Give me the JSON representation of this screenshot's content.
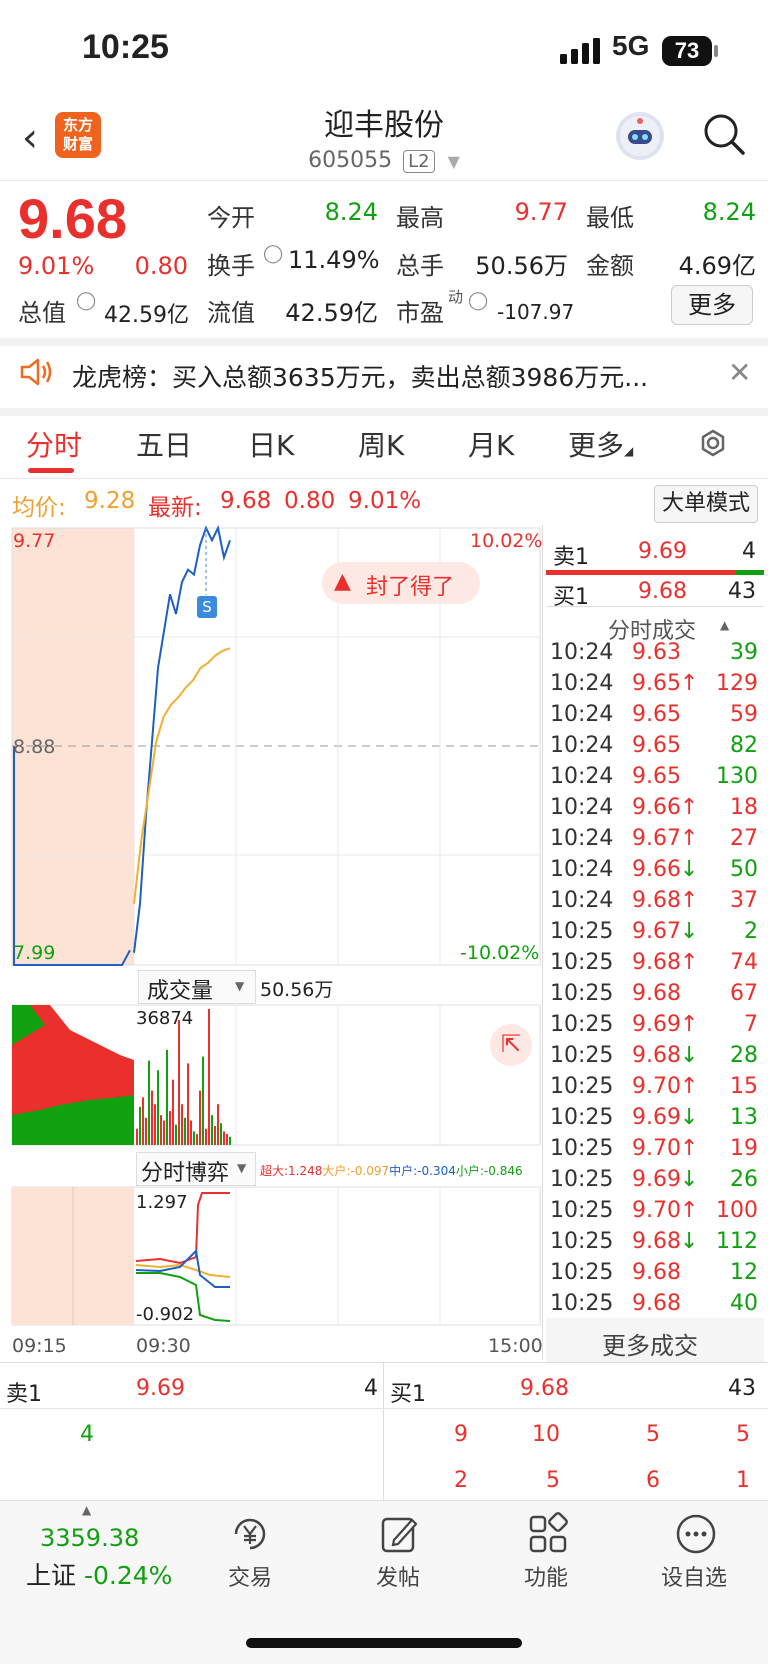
{
  "status_bar": {
    "time": "10:25",
    "network": "5G",
    "battery": "73"
  },
  "header": {
    "app_logo": "东方\n财富",
    "stock_name": "迎丰股份",
    "stock_code": "605055",
    "level": "L2"
  },
  "quote": {
    "price": "9.68",
    "change_pct": "9.01%",
    "change": "0.80",
    "open_label": "今开",
    "open": "8.24",
    "high_label": "最高",
    "high": "9.77",
    "low_label": "最低",
    "low": "8.24",
    "turnover_label": "换手",
    "turnover": "11.49%",
    "volume_label": "总手",
    "volume": "50.56万",
    "amount_label": "金额",
    "amount": "4.69亿",
    "mcap_label": "总值",
    "mcap": "42.59亿",
    "float_label": "流值",
    "float": "42.59亿",
    "pe_label": "市盈",
    "pe_sup": "动",
    "pe": "-107.97",
    "more": "更多"
  },
  "banner": {
    "text": "龙虎榜：买入总额3635万元，卖出总额3986万元..."
  },
  "tabs": [
    "分时",
    "五日",
    "日K",
    "周K",
    "月K",
    "更多"
  ],
  "info": {
    "avg_label": "均价:",
    "avg": "9.28",
    "latest_label": "最新:",
    "latest": "9.68",
    "change": "0.80",
    "pct": "9.01%",
    "big_order": "大单模式"
  },
  "chart": {
    "y_top": "9.77",
    "y_mid": "8.88",
    "y_bottom": "7.99",
    "pct_top": "10.02%",
    "pct_bottom": "-10.02%",
    "badge": "封了得了",
    "volume_label": "成交量",
    "volume_total": "50.56万",
    "volume_max": "36874",
    "game_label": "分时博弈",
    "game_legend": [
      "超大:1.248",
      "大户:-0.097",
      "中户:-0.304",
      "小户:-0.846"
    ],
    "game_top": "1.297",
    "game_bottom": "-0.902",
    "time_labels": [
      "09:15",
      "09:30",
      "15:00"
    ],
    "price_series": [
      7.99,
      7.99,
      7.99,
      8.04,
      8.24,
      8.6,
      8.9,
      9.2,
      9.35,
      9.5,
      9.42,
      9.55,
      9.6,
      9.58,
      9.7,
      9.77,
      9.72,
      9.77,
      9.65,
      9.72
    ],
    "avg_series": [
      8.24,
      8.5,
      8.7,
      8.9,
      9.0,
      9.05,
      9.08,
      9.12,
      9.15,
      9.2,
      9.22,
      9.25,
      9.27,
      9.28
    ],
    "volume_bars": [
      12,
      28,
      35,
      20,
      62,
      40,
      30,
      55,
      22,
      18,
      70,
      25,
      48,
      15,
      92,
      30,
      20,
      60,
      18,
      10,
      8,
      40,
      65,
      12,
      100,
      22,
      14,
      30,
      16,
      10,
      8,
      6
    ],
    "colors": {
      "up": "#e9302d",
      "down": "#10a010",
      "price_line": "#1f5fc0",
      "avg_line": "#f0b030",
      "preopen_bg": "#fde3d6"
    }
  },
  "orderbook_top": {
    "sell_label": "卖1",
    "sell_price": "9.69",
    "sell_vol": "4",
    "buy_label": "买1",
    "buy_price": "9.68",
    "buy_vol": "43"
  },
  "trades_title": "分时成交",
  "trades": [
    {
      "t": "10:24",
      "p": "9.63",
      "a": "",
      "v": "39",
      "c": "red",
      "vc": "green"
    },
    {
      "t": "10:24",
      "p": "9.65",
      "a": "↑",
      "v": "129",
      "c": "red",
      "vc": "red"
    },
    {
      "t": "10:24",
      "p": "9.65",
      "a": "",
      "v": "59",
      "c": "red",
      "vc": "red"
    },
    {
      "t": "10:24",
      "p": "9.65",
      "a": "",
      "v": "82",
      "c": "red",
      "vc": "green"
    },
    {
      "t": "10:24",
      "p": "9.65",
      "a": "",
      "v": "130",
      "c": "red",
      "vc": "green"
    },
    {
      "t": "10:24",
      "p": "9.66",
      "a": "↑",
      "v": "18",
      "c": "red",
      "vc": "red"
    },
    {
      "t": "10:24",
      "p": "9.67",
      "a": "↑",
      "v": "27",
      "c": "red",
      "vc": "red"
    },
    {
      "t": "10:24",
      "p": "9.66",
      "a": "↓",
      "v": "50",
      "c": "red",
      "vc": "green"
    },
    {
      "t": "10:24",
      "p": "9.68",
      "a": "↑",
      "v": "37",
      "c": "red",
      "vc": "red"
    },
    {
      "t": "10:25",
      "p": "9.67",
      "a": "↓",
      "v": "2",
      "c": "red",
      "vc": "green"
    },
    {
      "t": "10:25",
      "p": "9.68",
      "a": "↑",
      "v": "74",
      "c": "red",
      "vc": "red"
    },
    {
      "t": "10:25",
      "p": "9.68",
      "a": "",
      "v": "67",
      "c": "red",
      "vc": "red"
    },
    {
      "t": "10:25",
      "p": "9.69",
      "a": "↑",
      "v": "7",
      "c": "red",
      "vc": "red"
    },
    {
      "t": "10:25",
      "p": "9.68",
      "a": "↓",
      "v": "28",
      "c": "red",
      "vc": "green"
    },
    {
      "t": "10:25",
      "p": "9.70",
      "a": "↑",
      "v": "15",
      "c": "red",
      "vc": "red"
    },
    {
      "t": "10:25",
      "p": "9.69",
      "a": "↓",
      "v": "13",
      "c": "red",
      "vc": "green"
    },
    {
      "t": "10:25",
      "p": "9.70",
      "a": "↑",
      "v": "19",
      "c": "red",
      "vc": "red"
    },
    {
      "t": "10:25",
      "p": "9.69",
      "a": "↓",
      "v": "26",
      "c": "red",
      "vc": "green"
    },
    {
      "t": "10:25",
      "p": "9.70",
      "a": "↑",
      "v": "100",
      "c": "red",
      "vc": "red"
    },
    {
      "t": "10:25",
      "p": "9.68",
      "a": "↓",
      "v": "112",
      "c": "red",
      "vc": "green"
    },
    {
      "t": "10:25",
      "p": "9.68",
      "a": "",
      "v": "12",
      "c": "red",
      "vc": "green"
    },
    {
      "t": "10:25",
      "p": "9.68",
      "a": "",
      "v": "40",
      "c": "red",
      "vc": "green"
    }
  ],
  "more_trades": "更多成交",
  "bottom_book": {
    "sell_label": "卖1",
    "sell_price": "9.69",
    "sell_vol": "4",
    "sell_sub": "4",
    "buy_label": "买1",
    "buy_price": "9.68",
    "buy_vol": "43",
    "buy_row1": [
      "9",
      "10",
      "5",
      "5"
    ],
    "buy_row2": [
      "2",
      "5",
      "6",
      "1"
    ]
  },
  "nav": {
    "index_value": "3359.38",
    "index_name": "上证",
    "index_pct": "-0.24%",
    "trade": "交易",
    "post": "发帖",
    "func": "功能",
    "watch": "设自选"
  }
}
